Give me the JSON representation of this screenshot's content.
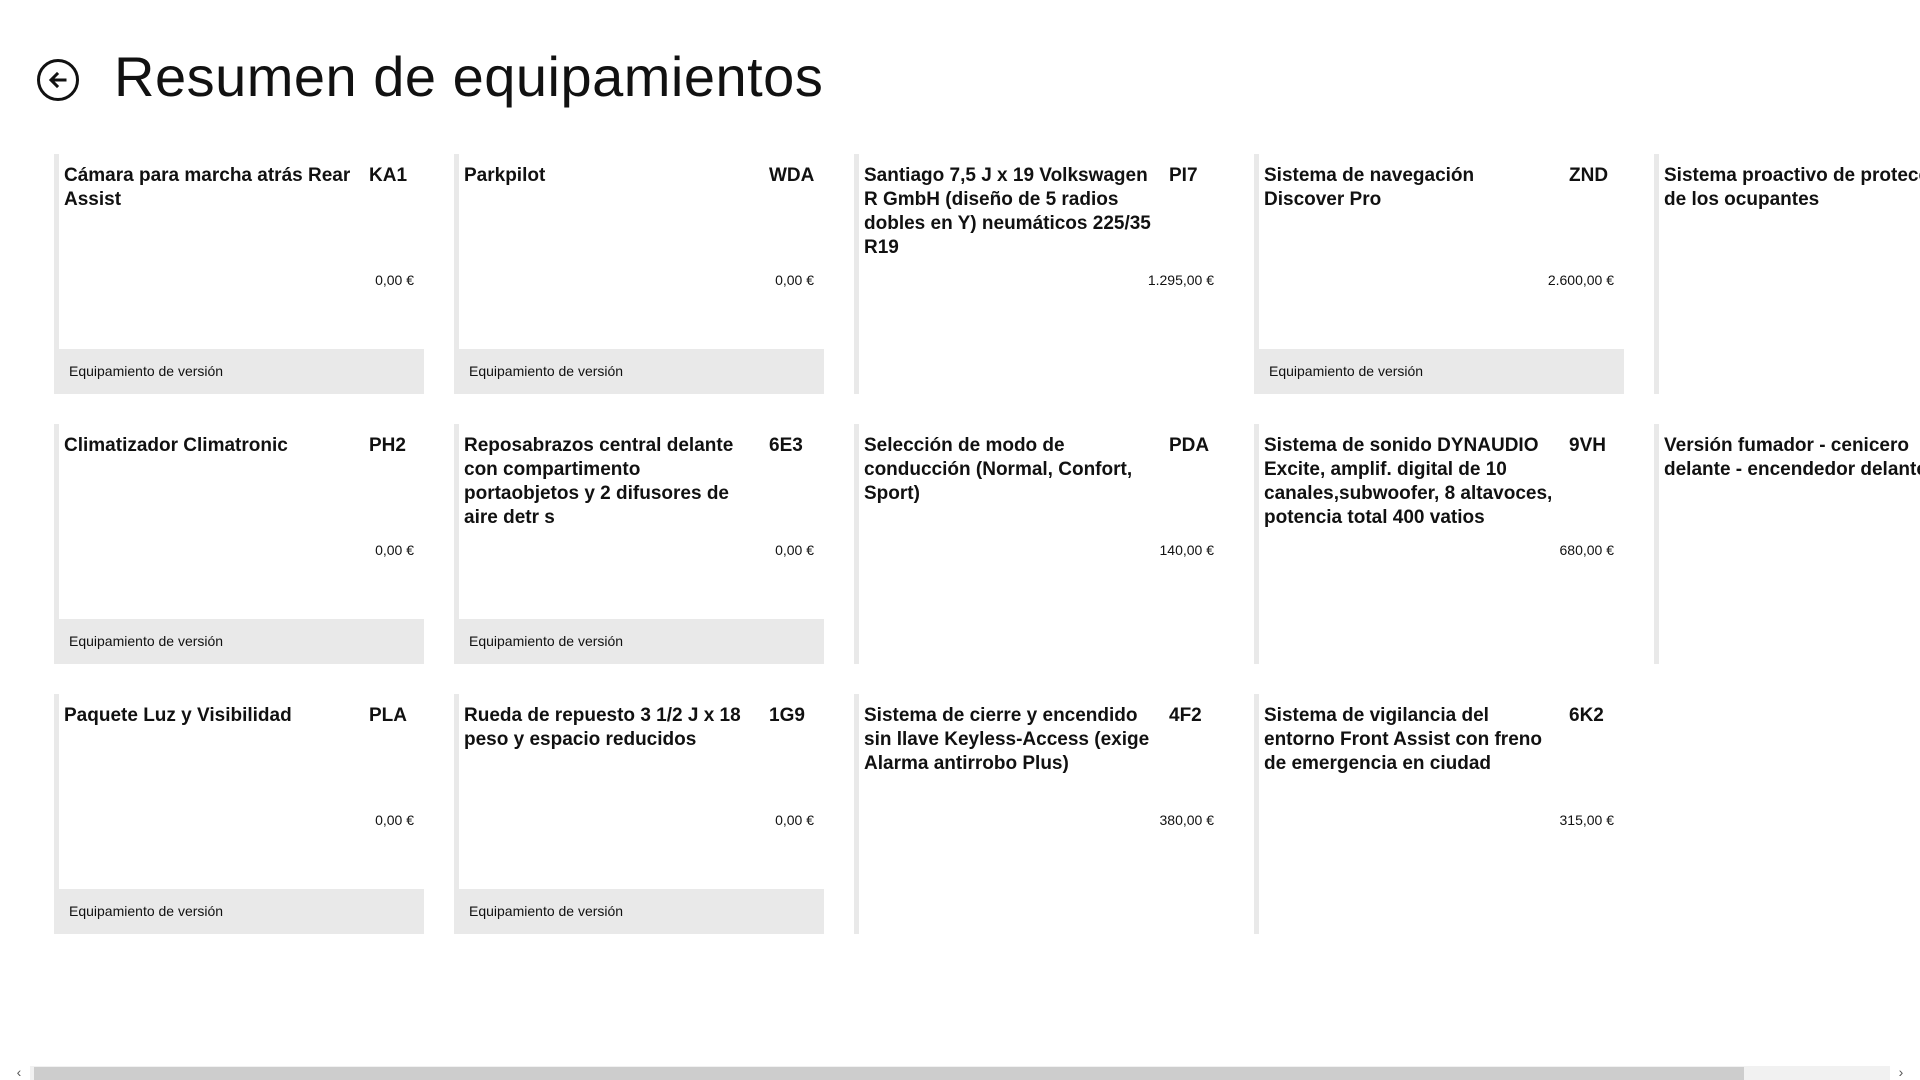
{
  "header": {
    "title": "Resumen de equipamientos",
    "back_icon": "arrow-left-circle-icon"
  },
  "tiles": [
    {
      "name": "Cámara para marcha atrás Rear Assist",
      "code": "KA1",
      "price": "0,00 €",
      "footer": "Equipamiento de versión"
    },
    {
      "name": "Climatizador Climatronic",
      "code": "PH2",
      "price": "0,00 €",
      "footer": "Equipamiento de versión"
    },
    {
      "name": "Paquete Luz y Visibilidad",
      "code": "PLA",
      "price": "0,00 €",
      "footer": "Equipamiento de versión"
    },
    {
      "name": "Parkpilot",
      "code": "WDA",
      "price": "0,00 €",
      "footer": "Equipamiento de versión"
    },
    {
      "name": "Reposabrazos central delante con compartimento portaobjetos y 2 difusores de aire detr s",
      "code": "6E3",
      "price": "0,00 €",
      "footer": "Equipamiento de versión"
    },
    {
      "name": "Rueda de repuesto 3 1/2 J x 18 peso y espacio reducidos",
      "code": "1G9",
      "price": "0,00 €",
      "footer": "Equipamiento de versión"
    },
    {
      "name": "Santiago 7,5 J x 19 Volkswagen R GmbH (diseño de 5 radios dobles en Y) neumáticos 225/35 R19",
      "code": "PI7",
      "price": "1.295,00 €",
      "footer": ""
    },
    {
      "name": "Selección de modo de conducción (Normal, Confort, Sport)",
      "code": "PDA",
      "price": "140,00 €",
      "footer": ""
    },
    {
      "name": "Sistema de cierre y encendido sin llave Keyless-Access (exige Alarma antirrobo Plus)",
      "code": "4F2",
      "price": "380,00 €",
      "footer": ""
    },
    {
      "name": "Sistema de navegación Discover Pro",
      "code": "ZND",
      "price": "2.600,00 €",
      "footer": "Equipamiento de versión"
    },
    {
      "name": "Sistema de sonido DYNAUDIO Excite, amplif. digital de 10 canales,subwoofer, 8 altavoces, potencia total 400 vatios",
      "code": "9VH",
      "price": "680,00 €",
      "footer": ""
    },
    {
      "name": "Sistema de vigilancia del entorno Front Assist con freno de emergencia en ciudad",
      "code": "6K2",
      "price": "315,00 €",
      "footer": ""
    },
    {
      "name": "Sistema proactivo de protecci de los ocupantes",
      "code": "",
      "price": "",
      "footer": ""
    },
    {
      "name": "Versión fumador - cenicero delante - encendedor delante",
      "code": "",
      "price": "",
      "footer": ""
    }
  ],
  "scrollbar": {
    "left_arrow": "‹",
    "right_arrow": "›"
  }
}
